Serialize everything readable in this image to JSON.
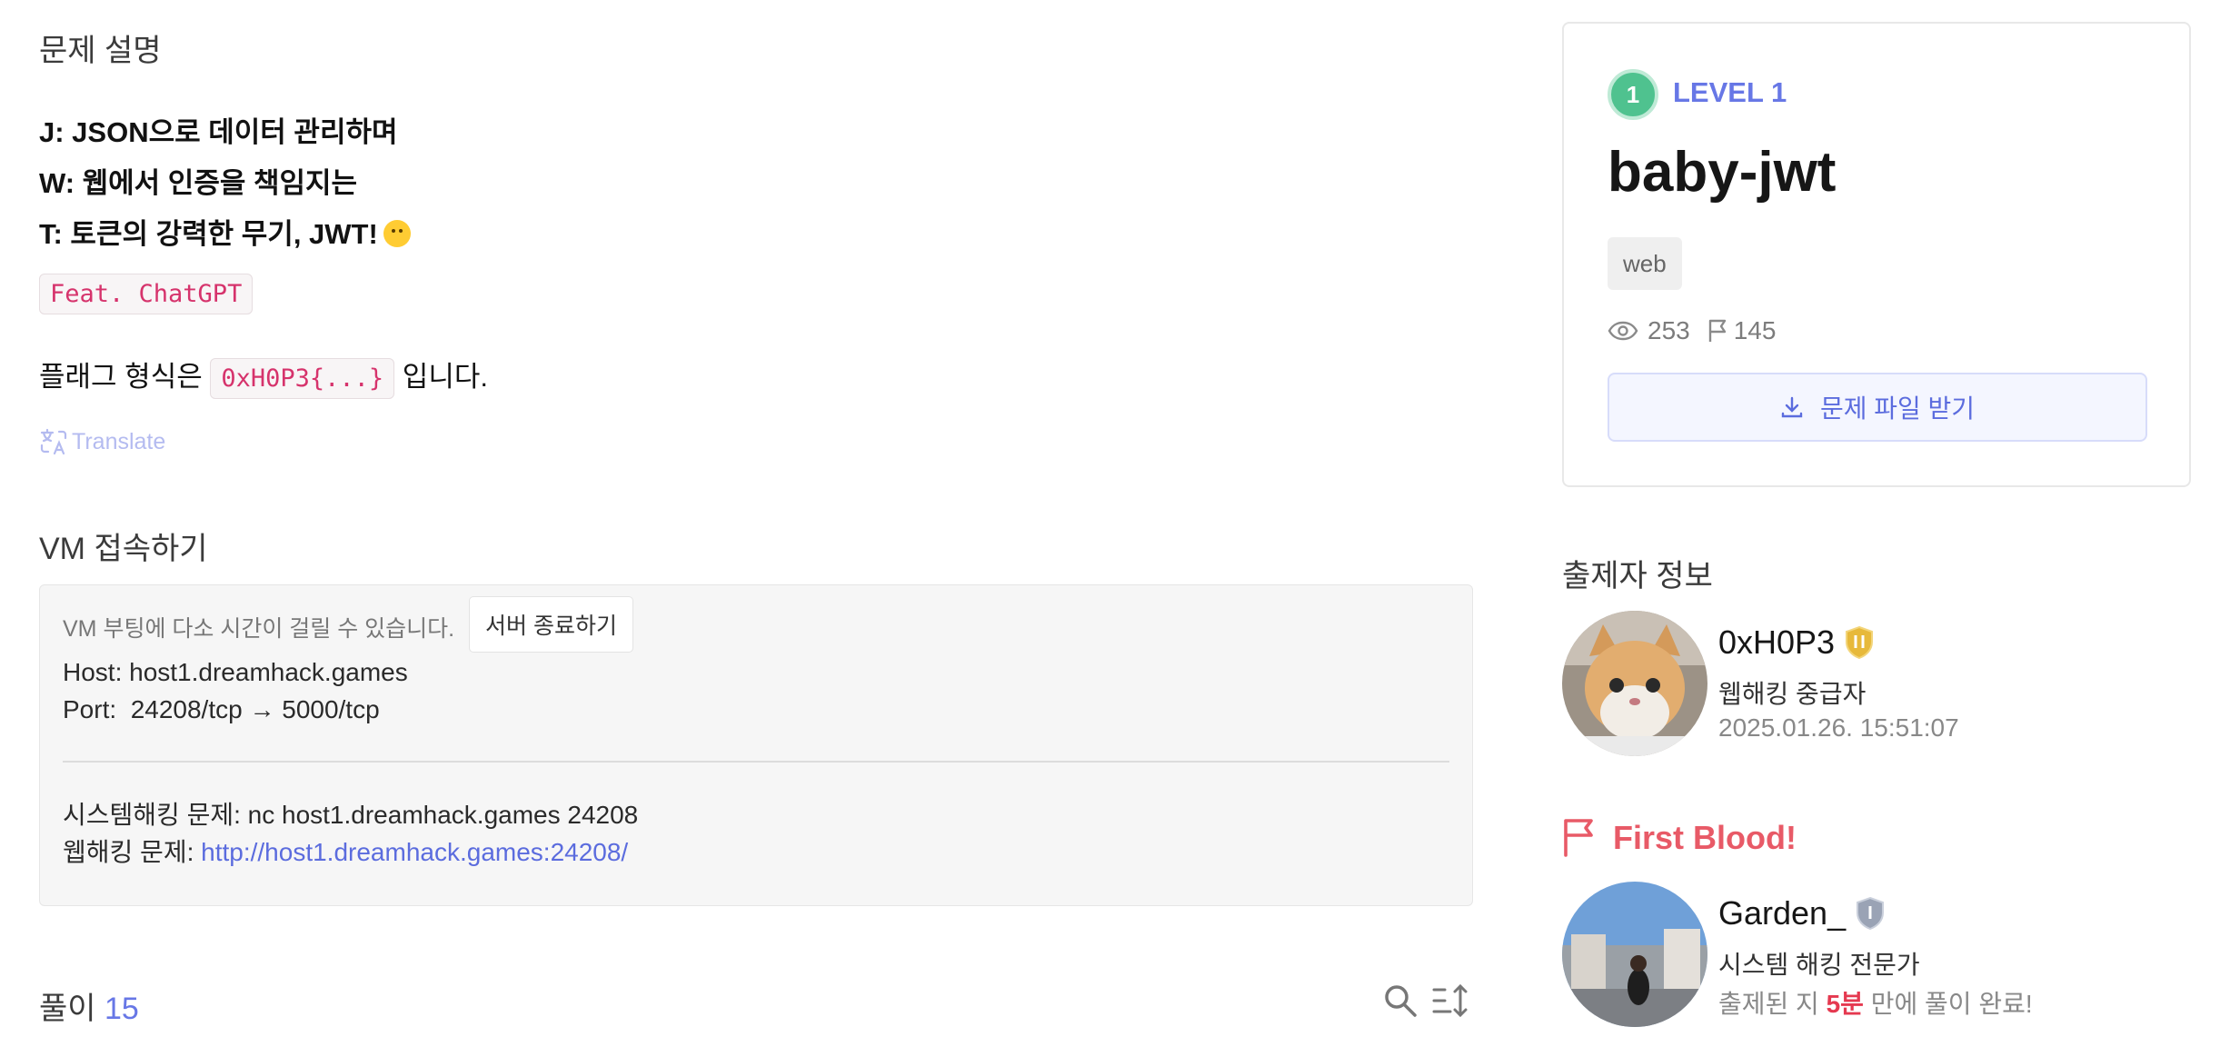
{
  "description": {
    "heading": "문제 설명",
    "lines": [
      "J: JSON으로 데이터 관리하며",
      "W: 웹에서 인증을 책임지는",
      "T: 토큰의 강력한 무기, JWT!"
    ],
    "feat_badge": "Feat. ChatGPT",
    "flag_prefix": "플래그 형식은",
    "flag_format": "0xH0P3{...}",
    "flag_suffix": "입니다.",
    "translate_label": "Translate"
  },
  "vm": {
    "heading": "VM 접속하기",
    "note": "VM 부팅에 다소 시간이 걸릴 수 있습니다.",
    "stop_button": "서버 종료하기",
    "host": "Host: host1.dreamhack.games",
    "port": "Port:  24208/tcp → 5000/tcp",
    "system_hacking": "시스템해킹 문제: nc host1.dreamhack.games 24208",
    "web_hacking_label": "웹해킹 문제: ",
    "web_hacking_url": "http://host1.dreamhack.games:24208/"
  },
  "solutions": {
    "label": "풀이",
    "count": "15"
  },
  "challenge": {
    "level_number": "1",
    "level_label": "LEVEL 1",
    "title": "baby-jwt",
    "tag": "web",
    "views": "253",
    "solves": "145",
    "download_button": "문제 파일 받기"
  },
  "author": {
    "heading": "출제자 정보",
    "name": "0xH0P3",
    "rank_badge": "II",
    "role": "웹해킹 중급자",
    "date": "2025.01.26. 15:51:07"
  },
  "first_blood": {
    "heading": "First Blood!",
    "name": "Garden_",
    "rank_badge": "I",
    "role": "시스템 해킹 전문가",
    "time_prefix": "출제된 지 ",
    "time_value": "5분",
    "time_suffix": " 만에 풀이 완료!"
  },
  "colors": {
    "accent": "#6777e6",
    "level_green": "#4fc28f",
    "first_blood": "#e85a67",
    "code": "#d6336c"
  },
  "icons": [
    "emoji-smile-icon",
    "translate-icon",
    "eye-icon",
    "flag-icon",
    "download-icon",
    "search-icon",
    "sort-icon",
    "rank-gold-icon",
    "rank-silver-icon",
    "first-blood-flag-icon"
  ]
}
